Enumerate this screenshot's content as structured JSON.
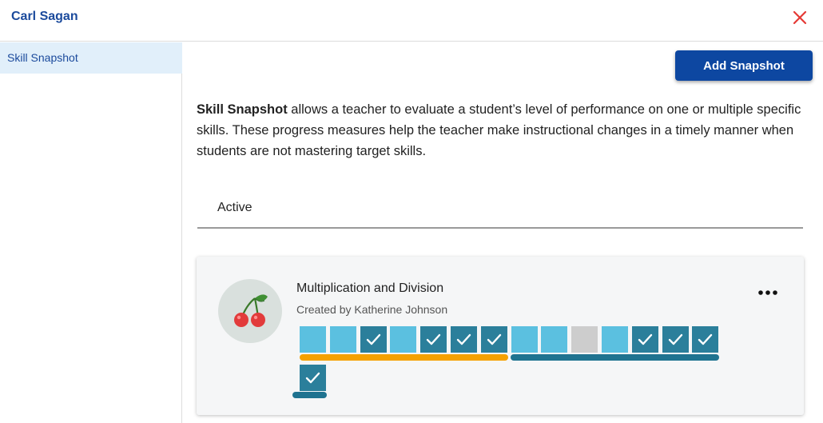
{
  "header": {
    "student_name": "Carl Sagan"
  },
  "sidebar": {
    "items": [
      {
        "label": "Skill Snapshot"
      }
    ]
  },
  "main": {
    "add_button_label": "Add Snapshot",
    "description": {
      "bold_term": "Skill Snapshot",
      "text": " allows a teacher to evaluate a student’s level of performance on one or multiple specific skills. These progress measures help the teacher make instructional changes in a timely manner when students are not mastering target skills."
    },
    "tabs": [
      {
        "label": "Active"
      }
    ],
    "snapshot_card": {
      "title": "Multiplication and Division",
      "created_by": "Created by Katherine Johnson",
      "avatar_icon": "cherry-icon",
      "menu_icon": "more-horizontal-icon",
      "assessment_items": [
        "light",
        "light",
        "check",
        "light",
        "check",
        "check",
        "check",
        "light",
        "light",
        "gray",
        "light",
        "check",
        "check",
        "check",
        "check"
      ]
    }
  },
  "colors": {
    "brand_blue": "#0d47a1",
    "title_blue": "#1b4a9c",
    "close_red": "#e53935",
    "square_light": "#5bc0e0",
    "square_checked": "#2b7f9b",
    "square_empty": "#cdcdcd",
    "progress_orange": "#f5a100",
    "progress_teal": "#1f7390"
  }
}
